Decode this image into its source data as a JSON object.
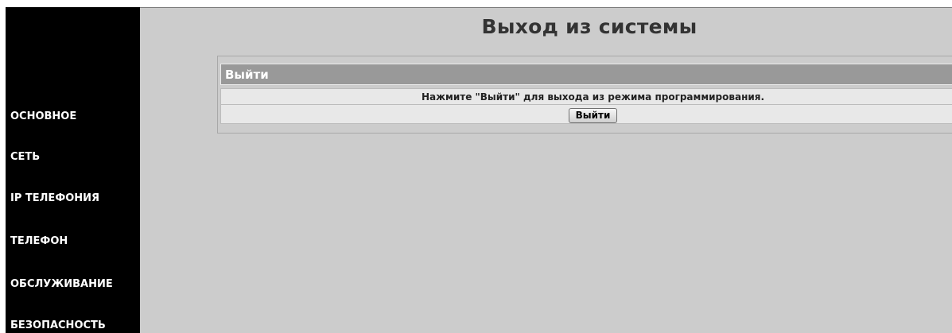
{
  "sidebar": {
    "items": [
      {
        "label": "ОСНОВНОЕ"
      },
      {
        "label": "СЕТЬ"
      },
      {
        "label": "IP ТЕЛЕФОНИЯ"
      },
      {
        "label": "ТЕЛЕФОН"
      },
      {
        "label": "ОБСЛУЖИВАНИЕ"
      },
      {
        "label": "БЕЗОПАСНОСТЬ"
      }
    ]
  },
  "page": {
    "title": "Выход из системы"
  },
  "logout_panel": {
    "header": "Выйти",
    "message": "Нажмите \"Выйти\" для выхода из режима программирования.",
    "button_label": "Выйти"
  }
}
